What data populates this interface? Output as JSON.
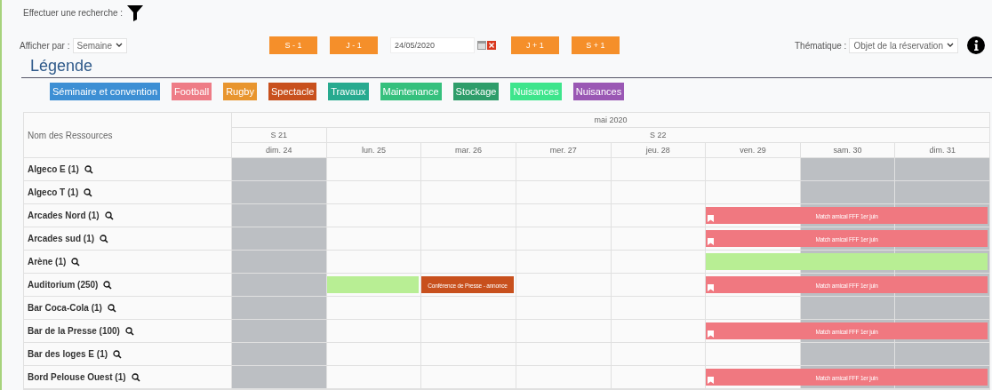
{
  "search": {
    "label": "Effectuer une recherche :"
  },
  "toolbar": {
    "view_label": "Afficher par :",
    "view_value": "Semaine",
    "buttons": [
      {
        "label": "S - 1"
      },
      {
        "label": "J - 1"
      }
    ],
    "date": "24/05/2020",
    "buttons_after": [
      {
        "label": "J + 1"
      },
      {
        "label": "S + 1"
      }
    ],
    "theme_label": "Thématique :",
    "theme_value": "Objet de la réservation"
  },
  "legend": {
    "title": "Légende",
    "items": [
      {
        "label": "Séminaire et convention",
        "color": "#3d8fd4"
      },
      {
        "label": "Football",
        "color": "#ee7c86"
      },
      {
        "label": "Rugby",
        "color": "#e8952e"
      },
      {
        "label": "Spectacle",
        "color": "#c8501d"
      },
      {
        "label": "Travaux",
        "color": "#27aa8f"
      },
      {
        "label": "Maintenance",
        "color": "#35c07d"
      },
      {
        "label": "Stockage",
        "color": "#2e9d6a"
      },
      {
        "label": "Nuisances",
        "color": "#3ee58c"
      },
      {
        "label": "Nuisances",
        "color": "#9a58b4"
      }
    ]
  },
  "table": {
    "resource_header": "Nom des Ressources",
    "month": "mai 2020",
    "weeks": [
      {
        "label": "S 21",
        "days": [
          {
            "label": "dim. 24",
            "weekend": true
          }
        ]
      },
      {
        "label": "S 22",
        "days": [
          {
            "label": "lun. 25",
            "weekend": false
          },
          {
            "label": "mar. 26",
            "weekend": false
          },
          {
            "label": "mer. 27",
            "weekend": false
          },
          {
            "label": "jeu. 28",
            "weekend": false
          },
          {
            "label": "ven. 29",
            "weekend": false
          },
          {
            "label": "sam. 30",
            "weekend": true
          },
          {
            "label": "dim. 31",
            "weekend": true
          }
        ]
      }
    ],
    "rows": [
      {
        "name": "Algeco E (1)",
        "events": []
      },
      {
        "name": "Algeco T (1)",
        "events": []
      },
      {
        "name": "Arcades Nord (1)",
        "events": [
          {
            "label": "Match amical FFF 1er juin",
            "color": "#f07880",
            "flag": true,
            "covers": [
              false,
              false,
              false,
              false,
              false,
              true,
              true,
              true
            ]
          }
        ]
      },
      {
        "name": "Arcades sud (1)",
        "events": [
          {
            "label": "Match amical FFF 1er juin",
            "color": "#f07880",
            "flag": true,
            "covers": [
              false,
              false,
              false,
              false,
              false,
              true,
              true,
              true
            ]
          }
        ]
      },
      {
        "name": "Arène (1)",
        "events": [
          {
            "color": "#b8ee94",
            "flag": false,
            "covers": [
              false,
              false,
              false,
              false,
              false,
              true,
              true,
              true
            ]
          }
        ]
      },
      {
        "name": "Auditorium (250)",
        "events": [
          {
            "color": "#b8ee94",
            "flag": false,
            "covers": [
              false,
              true,
              false,
              false,
              false,
              false,
              false,
              false
            ]
          },
          {
            "label": "Conférence de Presse - annonce",
            "color": "#c8501d",
            "flag": false,
            "covers": [
              false,
              false,
              true,
              false,
              false,
              false,
              false,
              false
            ]
          },
          {
            "label": "Match amical FFF 1er juin",
            "color": "#f07880",
            "flag": true,
            "covers": [
              false,
              false,
              false,
              false,
              false,
              true,
              true,
              true
            ]
          }
        ]
      },
      {
        "name": "Bar Coca-Cola (1)",
        "events": []
      },
      {
        "name": "Bar de la Presse (100)",
        "events": [
          {
            "label": "Match amical FFF 1er juin",
            "color": "#f07880",
            "flag": true,
            "covers": [
              false,
              false,
              false,
              false,
              false,
              true,
              true,
              true
            ]
          }
        ]
      },
      {
        "name": "Bar des loges E (1)",
        "events": []
      },
      {
        "name": "Bord Pelouse Ouest (1)",
        "events": [
          {
            "label": "Match amical FFF 1er juin",
            "color": "#f07880",
            "flag": true,
            "covers": [
              false,
              false,
              false,
              false,
              false,
              true,
              true,
              true
            ]
          }
        ]
      }
    ]
  }
}
